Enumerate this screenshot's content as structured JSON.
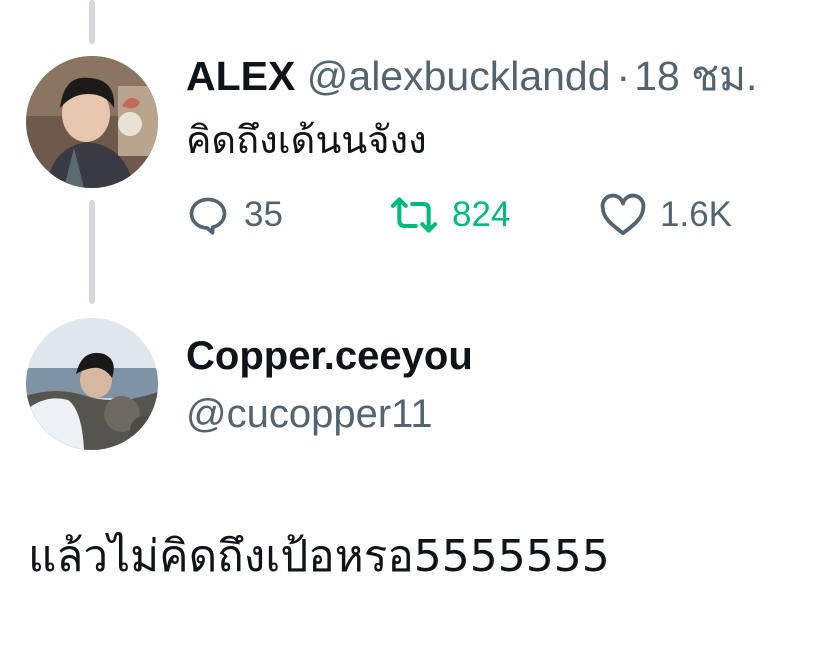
{
  "tweet": {
    "display_name": "ALEX",
    "handle": "@alexbucklandd",
    "separator": "·",
    "time": "18 ชม.",
    "text": "คิดถึงเด้นนจังง",
    "avatar_icon": "user-avatar-photo",
    "stats": {
      "replies": "35",
      "retweets": "824",
      "likes": "1.6K"
    },
    "icons": {
      "reply": "speech-bubble-icon",
      "retweet": "retweet-arrows-icon",
      "like": "heart-icon"
    },
    "colors": {
      "retweet_active": "#00ba7c",
      "muted": "#536471",
      "thread_line": "#cfd9de"
    }
  },
  "reply": {
    "display_name": "Copper.ceeyou",
    "handle": "@cucopper11",
    "text": "แล้วไม่คิดถึงเป้อหรอ5555555",
    "avatar_icon": "user-avatar-photo"
  }
}
